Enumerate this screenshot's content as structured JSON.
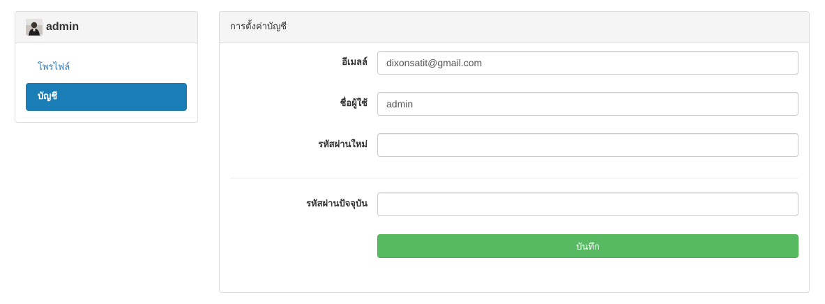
{
  "sidebar": {
    "title": "admin",
    "items": [
      {
        "label": "โพรไฟล์",
        "active": false
      },
      {
        "label": "บัญชี",
        "active": true
      }
    ]
  },
  "main": {
    "header": "การตั้งค่าบัญชี",
    "fields": {
      "email": {
        "label": "อีเมลล์",
        "value": "dixonsatit@gmail.com"
      },
      "username": {
        "label": "ชื่อผู้ใช้",
        "value": "admin"
      },
      "new_password": {
        "label": "รหัสผ่านใหม่",
        "value": ""
      },
      "current_password": {
        "label": "รหัสผ่านปัจจุบัน",
        "value": ""
      }
    },
    "save_label": "บันทึก"
  },
  "colors": {
    "active_nav": "#1a7db5",
    "link": "#337ab7",
    "save_button": "#57b962"
  },
  "icons": {
    "avatar": "user-avatar-photo"
  }
}
